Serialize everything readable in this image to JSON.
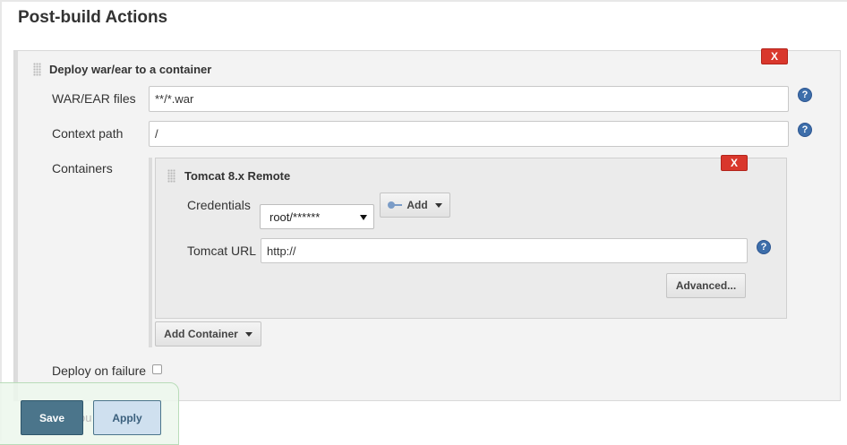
{
  "section": {
    "title": "Post-build Actions"
  },
  "deploy": {
    "title": "Deploy war/ear to a container",
    "delete_label": "X",
    "war_label": "WAR/EAR files",
    "war_value": "**/*.war",
    "context_label": "Context path",
    "context_value": "/",
    "containers_label": "Containers",
    "failure_label": "Deploy on failure",
    "add_container_label": "Add Container"
  },
  "container": {
    "title": "Tomcat 8.x Remote",
    "delete_label": "X",
    "credentials_label": "Credentials",
    "credentials_value": "root/******",
    "add_label": "Add",
    "url_label": "Tomcat URL",
    "url_value": "http://",
    "advanced_label": "Advanced..."
  },
  "footer": {
    "save_label": "Save",
    "apply_label": "Apply",
    "obscured_text": "ou"
  },
  "help_glyph": "?",
  "icons": {
    "help": "help-icon",
    "key": "key-icon",
    "grip": "drag-handle-icon",
    "caret": "chevron-down-icon"
  },
  "colors": {
    "delete": "#d9372c",
    "help": "#3d6eaa",
    "save": "#4b758b",
    "apply": "#cfe0ef"
  }
}
